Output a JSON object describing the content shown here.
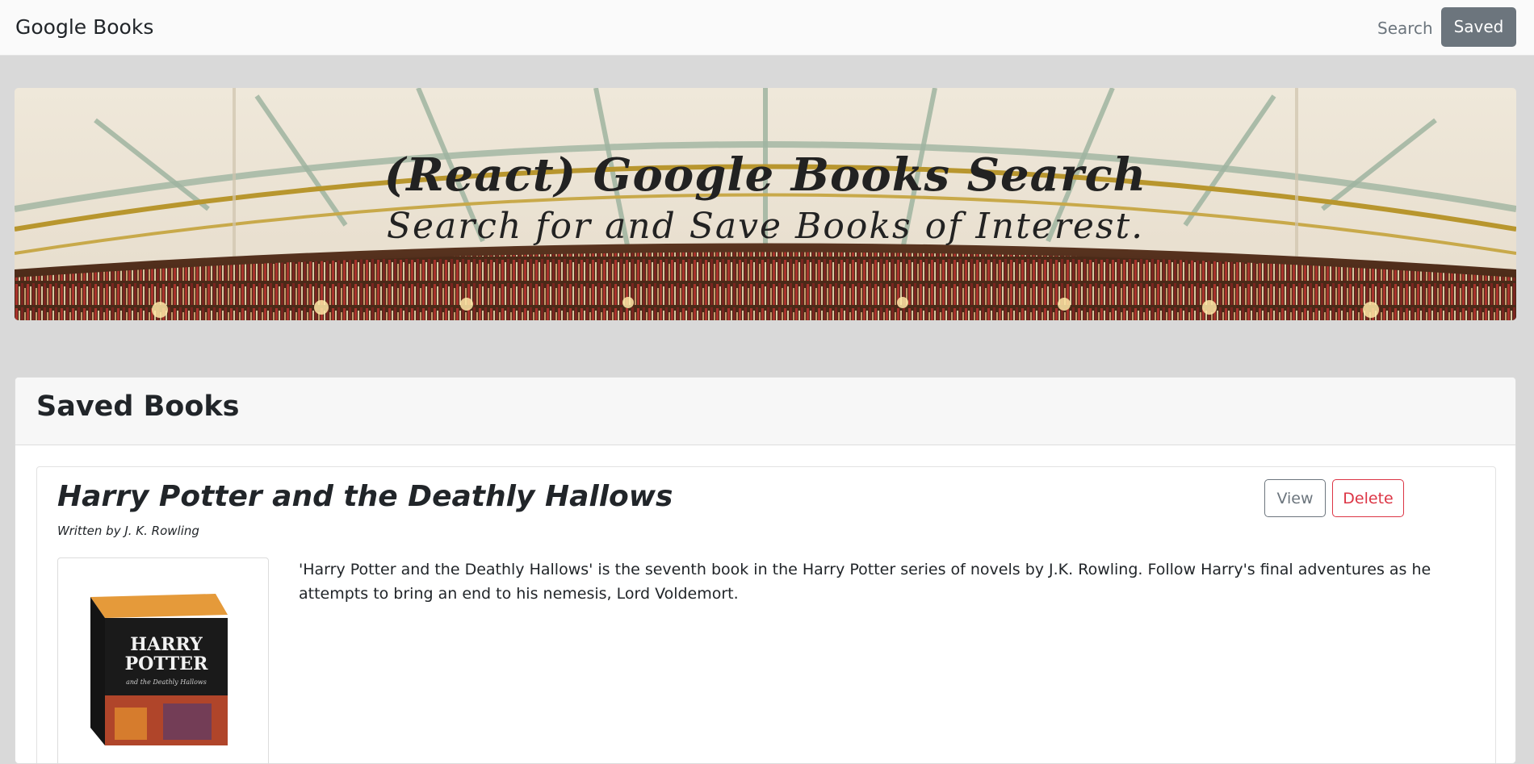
{
  "navbar": {
    "brand": "Google Books",
    "search_link": "Search",
    "saved_button": "Saved"
  },
  "hero": {
    "title": "(React) Google Books Search",
    "subtitle": "Search for and Save Books of Interest."
  },
  "saved": {
    "heading": "Saved Books",
    "books": [
      {
        "title": "Harry Potter and the Deathly Hallows",
        "author_line": "Written by J. K. Rowling",
        "description": "'Harry Potter and the Deathly Hallows' is the seventh book in the Harry Potter series of novels by J.K. Rowling. Follow Harry's final adventures as he attempts to bring an end to his nemesis, Lord Voldemort.",
        "view_label": "View",
        "delete_label": "Delete",
        "cover_text_line1": "HARRY",
        "cover_text_line2": "POTTER",
        "cover_text_line3": "and the Deathly Hallows"
      }
    ]
  },
  "colors": {
    "page_bg": "#d9d9d9",
    "navbar_bg": "#fafafa",
    "secondary": "#6c757d",
    "danger": "#dc3545"
  },
  "icons": {
    "hero_image": "library-dome-image",
    "cover_image": "book-cover-image"
  }
}
